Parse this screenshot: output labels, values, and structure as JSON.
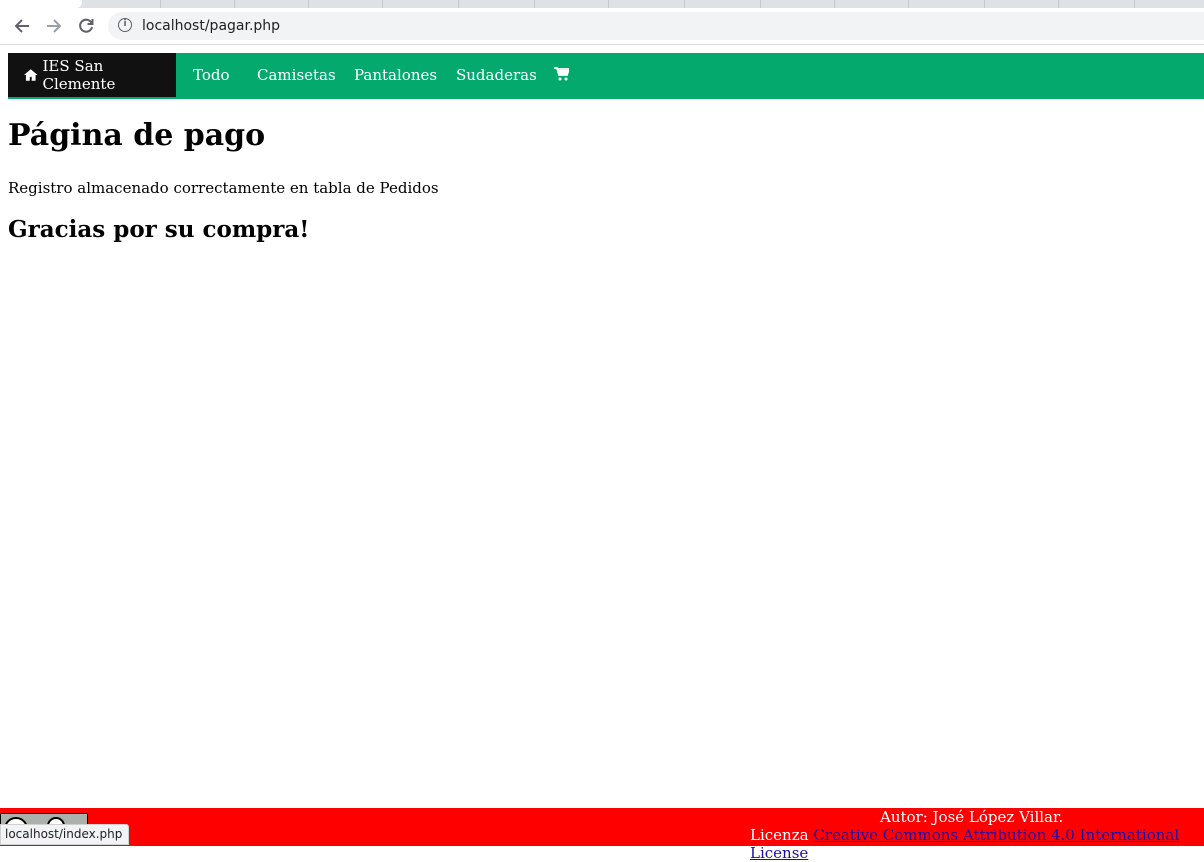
{
  "browser": {
    "url": "localhost/pagar.php",
    "status_url": "localhost/index.php"
  },
  "navbar": {
    "brand": "IES San Clemente",
    "items": [
      "Todo",
      "Camisetas",
      "Pantalones",
      "Sudaderas"
    ],
    "color": "#04aa6d",
    "brand_bg": "#111111"
  },
  "main": {
    "title": "Página de pago",
    "message": "Registro almacenado correctamente en tabla de Pedidos",
    "thanks": "Gracias por su compra!"
  },
  "footer": {
    "author": "Autor: José López Villar.",
    "license_prefix": "Licenza",
    "license_link": "Creative Commons Attribution 4.0 International License",
    "license_suffix": ".",
    "color": "#ff0000"
  }
}
